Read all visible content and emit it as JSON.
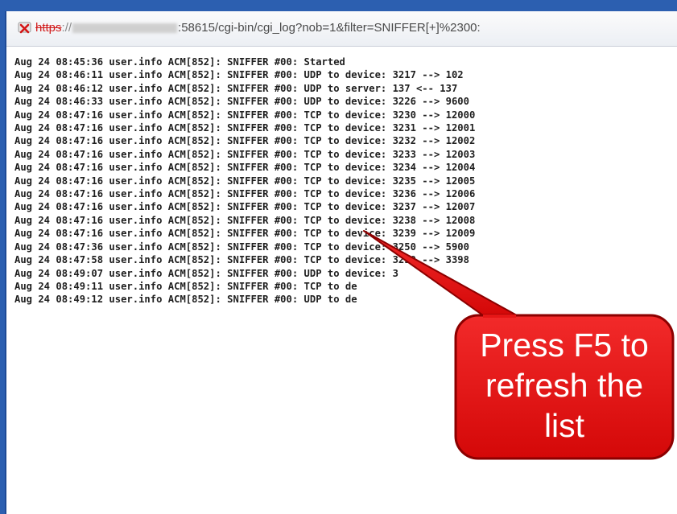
{
  "address_bar": {
    "scheme": "https",
    "separator": "://",
    "path": ":58615/cgi-bin/cgi_log?nob=1&filter=SNIFFER[+]%2300:"
  },
  "log_lines": [
    "Aug 24 08:45:36 user.info ACM[852]: SNIFFER #00: Started",
    "Aug 24 08:46:11 user.info ACM[852]: SNIFFER #00: UDP to device: 3217 --> 102",
    "Aug 24 08:46:12 user.info ACM[852]: SNIFFER #00: UDP to server: 137 <-- 137",
    "Aug 24 08:46:33 user.info ACM[852]: SNIFFER #00: UDP to device: 3226 --> 9600",
    "Aug 24 08:47:16 user.info ACM[852]: SNIFFER #00: TCP to device: 3230 --> 12000",
    "Aug 24 08:47:16 user.info ACM[852]: SNIFFER #00: TCP to device: 3231 --> 12001",
    "Aug 24 08:47:16 user.info ACM[852]: SNIFFER #00: TCP to device: 3232 --> 12002",
    "Aug 24 08:47:16 user.info ACM[852]: SNIFFER #00: TCP to device: 3233 --> 12003",
    "Aug 24 08:47:16 user.info ACM[852]: SNIFFER #00: TCP to device: 3234 --> 12004",
    "Aug 24 08:47:16 user.info ACM[852]: SNIFFER #00: TCP to device: 3235 --> 12005",
    "Aug 24 08:47:16 user.info ACM[852]: SNIFFER #00: TCP to device: 3236 --> 12006",
    "Aug 24 08:47:16 user.info ACM[852]: SNIFFER #00: TCP to device: 3237 --> 12007",
    "Aug 24 08:47:16 user.info ACM[852]: SNIFFER #00: TCP to device: 3238 --> 12008",
    "Aug 24 08:47:16 user.info ACM[852]: SNIFFER #00: TCP to device: 3239 --> 12009",
    "Aug 24 08:47:36 user.info ACM[852]: SNIFFER #00: TCP to device: 3250 --> 5900",
    "Aug 24 08:47:58 user.info ACM[852]: SNIFFER #00: TCP to device: 3259 --> 3398",
    "Aug 24 08:49:07 user.info ACM[852]: SNIFFER #00: UDP to device: 3",
    "Aug 24 08:49:11 user.info ACM[852]: SNIFFER #00: TCP to de",
    "Aug 24 08:49:12 user.info ACM[852]: SNIFFER #00: UDP to de"
  ],
  "callout": {
    "line1": "Press F5 to",
    "line2": "refresh the",
    "line3": "list",
    "fill_color": "#e01010",
    "border_color": "#8c0000"
  },
  "icons": {
    "security": "broken-lock-x-icon"
  }
}
